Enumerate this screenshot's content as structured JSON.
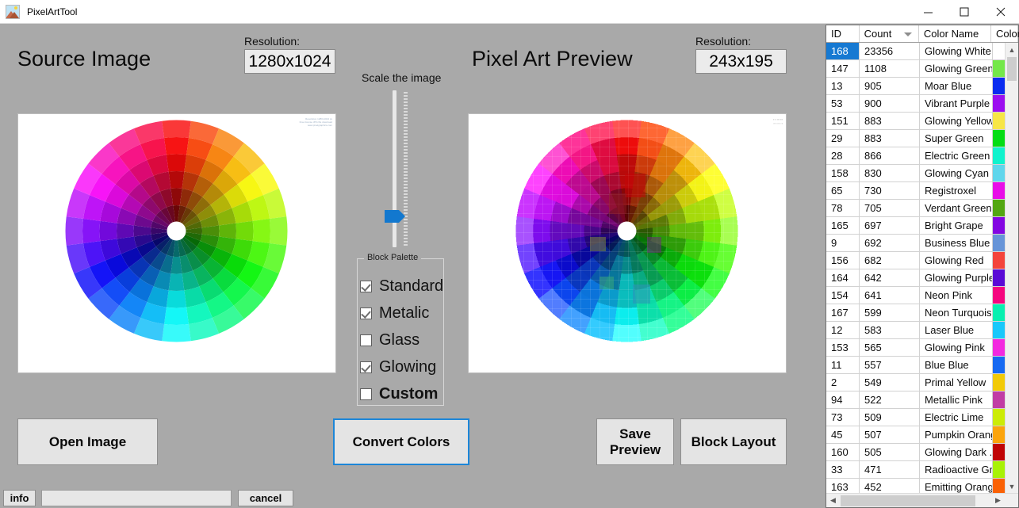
{
  "window": {
    "title": "PixelArtTool",
    "app_icon": "picture-image-icon",
    "minimize": "minimize-icon",
    "maximize": "maximize-icon",
    "close": "close-icon"
  },
  "source": {
    "heading": "Source Image",
    "resolution_label": "Resolution:",
    "resolution_value": "1280x1024",
    "watermark_line1": "Resolution 1280x1024 px",
    "watermark_line2": "Free license JPG file download",
    "watermark_line3": "www.pixelgraphics.com"
  },
  "preview": {
    "heading": "Pixel Art Preview",
    "resolution_label": "Resolution:",
    "resolution_value": "243x195"
  },
  "scale": {
    "label": "Scale the image",
    "thumb_name": "scale-slider-thumb",
    "value_position_pct": 69
  },
  "palette": {
    "legend": "Block Palette",
    "options": [
      {
        "label": "Standard",
        "checked": true,
        "bold": false
      },
      {
        "label": "Metalic",
        "checked": true,
        "bold": false
      },
      {
        "label": "Glass",
        "checked": false,
        "bold": false
      },
      {
        "label": "Glowing",
        "checked": true,
        "bold": false
      },
      {
        "label": "Custom",
        "checked": false,
        "bold": true
      }
    ]
  },
  "buttons": {
    "open_image": "Open Image",
    "convert_colors": "Convert Colors",
    "save_preview": "Save\nPreview",
    "save_preview_line1": "Save",
    "save_preview_line2": "Preview",
    "block_layout": "Block Layout"
  },
  "statusbar": {
    "info": "info",
    "field_value": "",
    "cancel": "cancel"
  },
  "grid": {
    "columns": [
      "ID",
      "Count",
      "Color Name",
      "Color"
    ],
    "sorted_column": "Count",
    "sort_direction": "descending",
    "selected_row_id": "168",
    "rows": [
      {
        "id": "168",
        "count": "23356",
        "name": "Glowing White",
        "color": "#ffffff"
      },
      {
        "id": "147",
        "count": "1108",
        "name": "Glowing Green",
        "color": "#74e84a"
      },
      {
        "id": "13",
        "count": "905",
        "name": "Moar Blue",
        "color": "#0a2bf0"
      },
      {
        "id": "53",
        "count": "900",
        "name": "Vibrant Purple",
        "color": "#9b0ef0"
      },
      {
        "id": "151",
        "count": "883",
        "name": "Glowing Yellow",
        "color": "#f7e646"
      },
      {
        "id": "29",
        "count": "883",
        "name": "Super Green",
        "color": "#03dd14"
      },
      {
        "id": "28",
        "count": "866",
        "name": "Electric Green",
        "color": "#10f3cd"
      },
      {
        "id": "158",
        "count": "830",
        "name": "Glowing Cyan",
        "color": "#5fd6ec"
      },
      {
        "id": "65",
        "count": "730",
        "name": "Registroxel",
        "color": "#e80de8"
      },
      {
        "id": "78",
        "count": "705",
        "name": "Verdant Green",
        "color": "#52a712"
      },
      {
        "id": "165",
        "count": "697",
        "name": "Bright Grape",
        "color": "#8306e2"
      },
      {
        "id": "9",
        "count": "692",
        "name": "Business Blue",
        "color": "#6694d8"
      },
      {
        "id": "156",
        "count": "682",
        "name": "Glowing Red",
        "color": "#f4443c"
      },
      {
        "id": "164",
        "count": "642",
        "name": "Glowing Purple",
        "color": "#5a0ad6"
      },
      {
        "id": "154",
        "count": "641",
        "name": "Neon Pink",
        "color": "#f5067f"
      },
      {
        "id": "167",
        "count": "599",
        "name": "Neon Turquoise",
        "color": "#07f0b0"
      },
      {
        "id": "12",
        "count": "583",
        "name": "Laser Blue",
        "color": "#18c8fb"
      },
      {
        "id": "153",
        "count": "565",
        "name": "Glowing Pink",
        "color": "#f32ae0"
      },
      {
        "id": "11",
        "count": "557",
        "name": "Blue Blue",
        "color": "#1669f2"
      },
      {
        "id": "2",
        "count": "549",
        "name": "Primal Yellow",
        "color": "#f2ca07"
      },
      {
        "id": "94",
        "count": "522",
        "name": "Metallic Pink",
        "color": "#c13da5"
      },
      {
        "id": "73",
        "count": "509",
        "name": "Electric Lime",
        "color": "#ccec06"
      },
      {
        "id": "45",
        "count": "507",
        "name": "Pumpkin Orange",
        "color": "#fba40c"
      },
      {
        "id": "160",
        "count": "505",
        "name": "Glowing Dark ...",
        "color": "#c00405"
      },
      {
        "id": "33",
        "count": "471",
        "name": "Radioactive Gr...",
        "color": "#a8f206"
      },
      {
        "id": "163",
        "count": "452",
        "name": "Emitting Orange",
        "color": "#fa6206"
      }
    ]
  },
  "color_wheel": {
    "hub_color": "#ffffff",
    "segments_per_ring": 24,
    "rings": 6,
    "hue_start_deg": 0
  }
}
